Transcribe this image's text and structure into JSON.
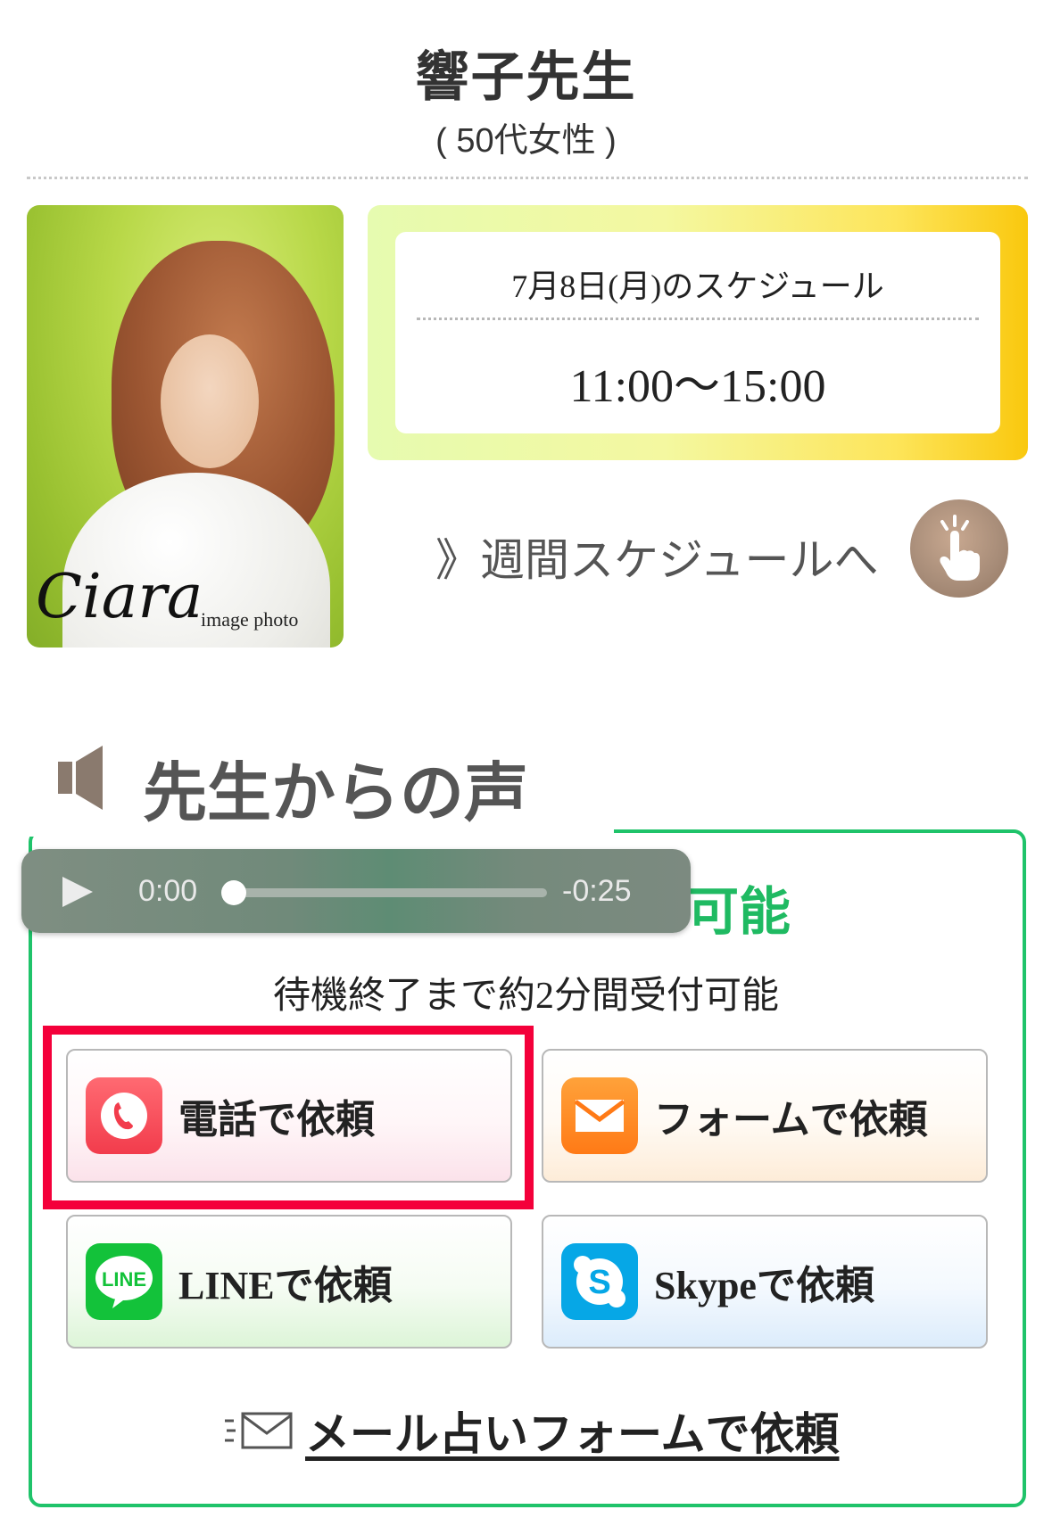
{
  "teacher": {
    "name": "響子先生",
    "age": "( 50代女性 )"
  },
  "photo": {
    "logo_text": "Ciara",
    "caption": "image photo"
  },
  "schedule": {
    "date_label": "7月8日(月)のスケジュール",
    "time_range": "11:00〜15:00"
  },
  "weekly_link": {
    "label": "》週間スケジュールへ",
    "icon": "pointing-hand-icon"
  },
  "voice": {
    "heading": "先生からの声",
    "icon": "speaker-icon",
    "player": {
      "current_time": "0:00",
      "remaining_time": "-0:25",
      "progress": 0
    }
  },
  "status": {
    "title_visible": "可能",
    "note": "待機終了まで約2分間受付可能",
    "accent": "#1fc36a"
  },
  "buttons": {
    "phone": {
      "label": "電話で依頼",
      "icon": "phone-icon",
      "color": "#f23c4c"
    },
    "form": {
      "label": "フォームで依頼",
      "icon": "envelope-icon",
      "color": "#ff7a16"
    },
    "line": {
      "label": "LINEで依頼",
      "icon": "line-icon",
      "icon_text": "LINE",
      "color": "#13c23a"
    },
    "skype": {
      "label": "Skypeで依頼",
      "icon": "skype-icon",
      "icon_text": "S",
      "color": "#06a7e6"
    }
  },
  "mail_link": {
    "label": "メール占いフォームで依頼",
    "icon": "mail-icon"
  },
  "highlight_color": "#f4003a"
}
